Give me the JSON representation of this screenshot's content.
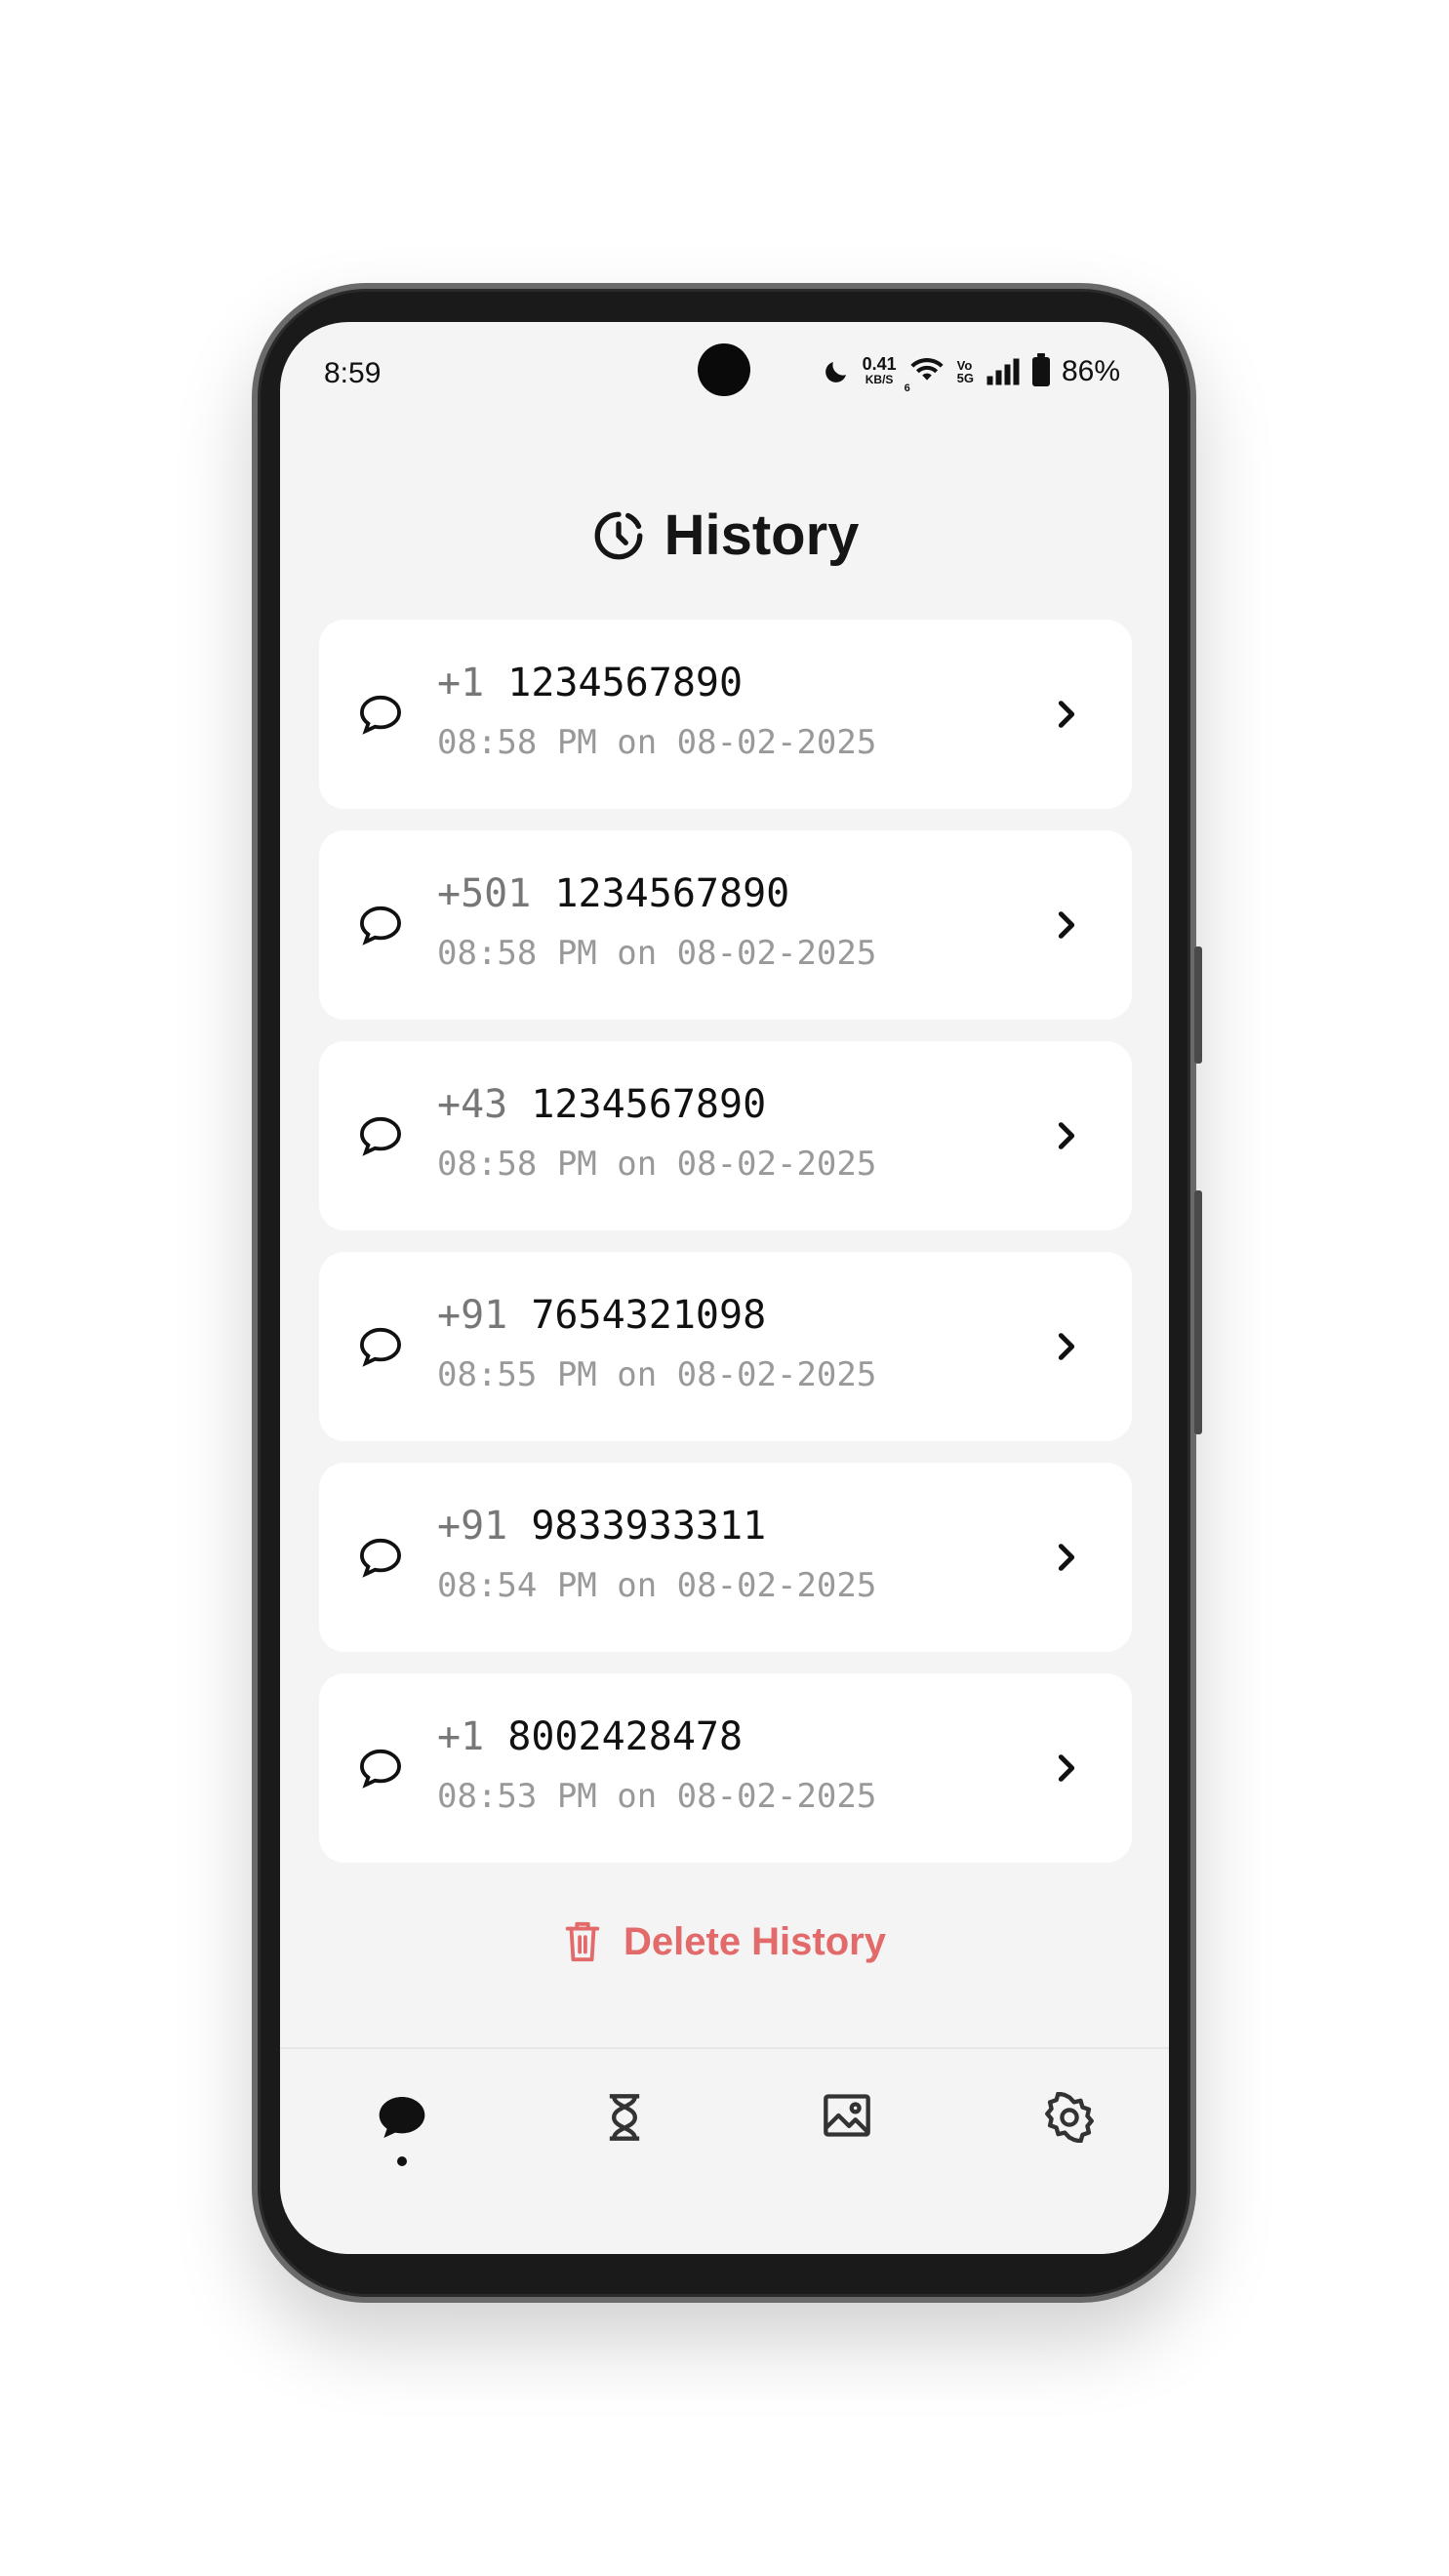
{
  "status_bar": {
    "time": "8:59",
    "net_speed_value": "0.41",
    "net_speed_unit": "KB/S",
    "wifi_badge": "6",
    "volte_top": "Vo",
    "volte_bottom": "5G",
    "battery": "86%"
  },
  "header": {
    "title": "History",
    "icon": "history-clock-icon"
  },
  "history": [
    {
      "code": "+1",
      "number": "1234567890",
      "when": "08:58 PM on 08-02-2025"
    },
    {
      "code": "+501",
      "number": "1234567890",
      "when": "08:58 PM on 08-02-2025"
    },
    {
      "code": "+43",
      "number": "1234567890",
      "when": "08:58 PM on 08-02-2025"
    },
    {
      "code": "+91",
      "number": "7654321098",
      "when": "08:55 PM on 08-02-2025"
    },
    {
      "code": "+91",
      "number": "9833933311",
      "when": "08:54 PM on 08-02-2025"
    },
    {
      "code": "+1",
      "number": "8002428478",
      "when": "08:53 PM on 08-02-2025"
    }
  ],
  "delete_button": {
    "label": "Delete History",
    "color": "#e36a6a",
    "icon": "trash-icon"
  },
  "bottom_nav": {
    "items": [
      {
        "icon": "chat-icon",
        "active": true
      },
      {
        "icon": "hourglass-icon",
        "active": false
      },
      {
        "icon": "image-icon",
        "active": false
      },
      {
        "icon": "gear-icon",
        "active": false
      }
    ]
  }
}
